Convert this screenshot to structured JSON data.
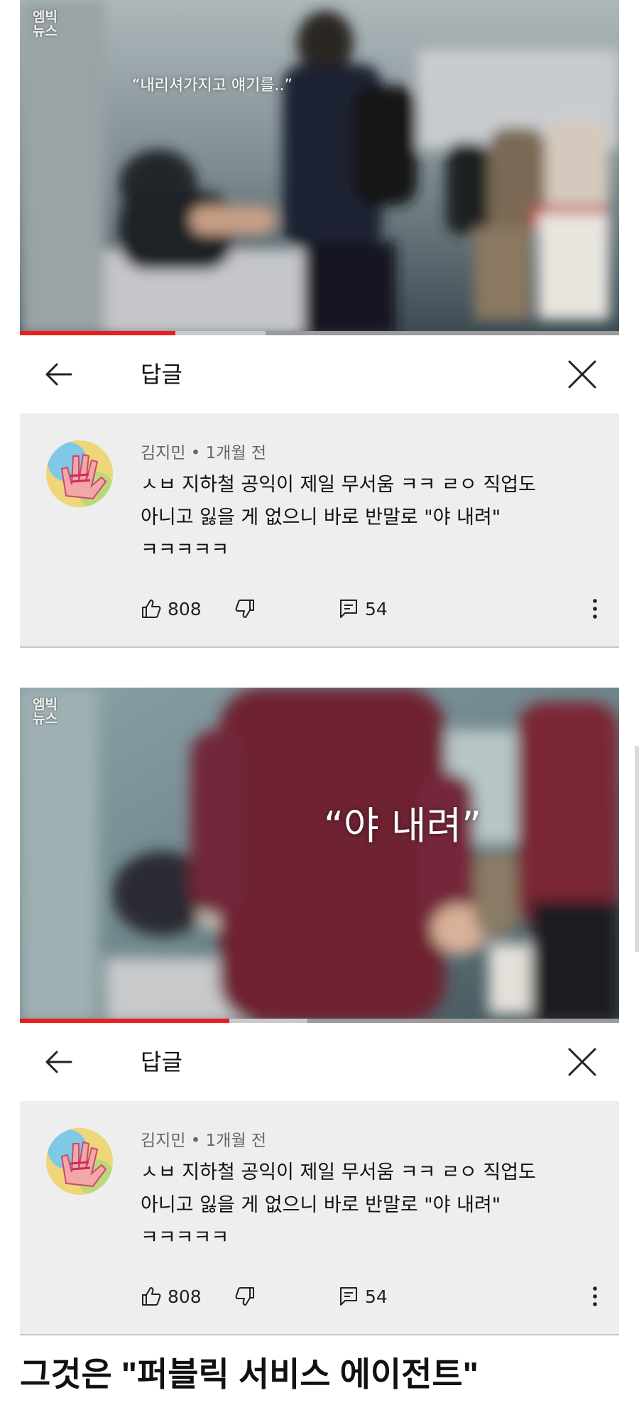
{
  "panel1": {
    "watermark": [
      "엠빅",
      "뉴스"
    ],
    "caption": "“내리셔가지고 얘기를..”",
    "progress": 0.26,
    "buffered": 0.41,
    "header": {
      "title": "답글"
    },
    "comment": {
      "meta": "김지민 • 1개월 전",
      "lines": [
        "ㅅㅂ 지하철 공익이 제일 무서움 ㅋㅋ ㄹㅇ 직업도",
        "아니고 잃을 게 없으니 바로 반말로 \"야 내려\"",
        "ㅋㅋㅋㅋㅋ"
      ],
      "likes": "808",
      "replies": "54"
    }
  },
  "panel2": {
    "watermark": [
      "엠빅",
      "뉴스"
    ],
    "caption": "“야 내려”",
    "progress": 0.35,
    "buffered": 0.48,
    "header": {
      "title": "답글"
    },
    "comment": {
      "meta": "김지민 • 1개월 전",
      "lines": [
        "ㅅㅂ 지하철 공익이 제일 무서움 ㅋㅋ ㄹㅇ 직업도",
        "아니고 잃을 게 없으니 바로 반말로 \"야 내려\"",
        "ㅋㅋㅋㅋㅋ"
      ],
      "likes": "808",
      "replies": "54"
    }
  },
  "headline": "그것은 \"퍼블릭 서비스 에이전트\"",
  "colors": {
    "progress": "#e81f1f",
    "comment_bg": "#eeeeee",
    "text": "#111111",
    "meta": "#666666"
  },
  "icons": [
    "back-arrow-icon",
    "close-icon",
    "thumbs-up-icon",
    "thumbs-down-icon",
    "reply-icon",
    "more-vert-icon"
  ]
}
